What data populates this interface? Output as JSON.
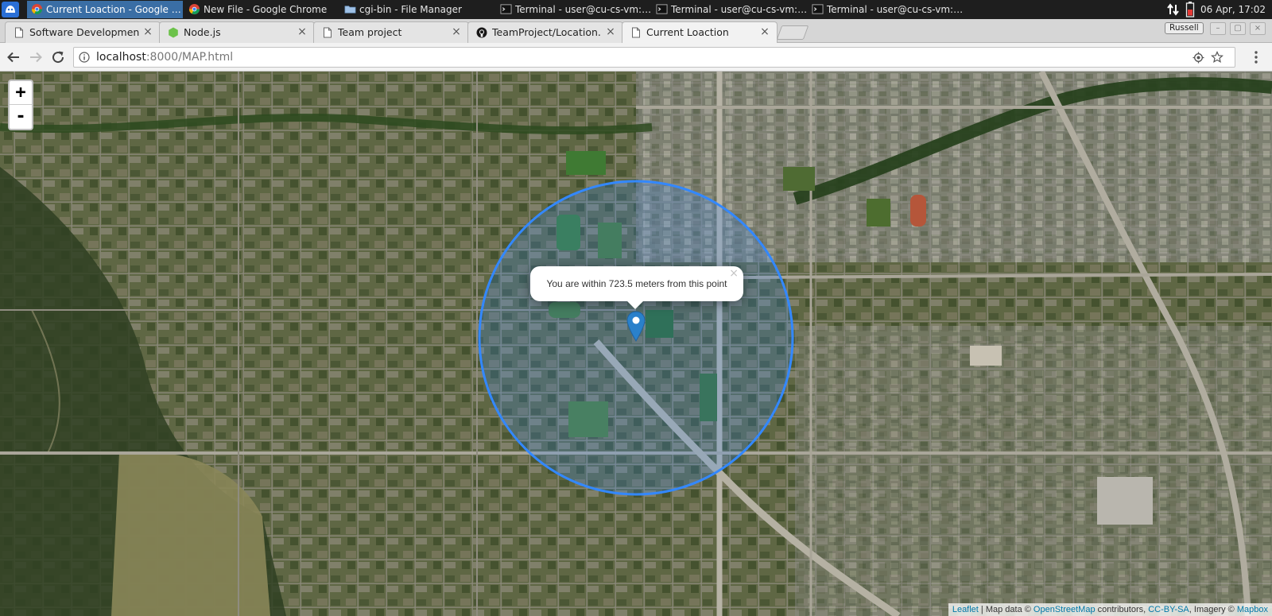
{
  "taskbar": {
    "items": [
      {
        "label": "Current Loaction - Google C...",
        "icon": "chrome-icon",
        "active": true
      },
      {
        "label": "New File - Google Chrome",
        "icon": "chrome-icon",
        "active": false
      },
      {
        "label": "cgi-bin - File Manager",
        "icon": "folder-icon",
        "active": false
      },
      {
        "label": "Terminal - user@cu-cs-vm: ~...",
        "icon": "terminal-icon",
        "active": false
      },
      {
        "label": "Terminal - user@cu-cs-vm: ~...",
        "icon": "terminal-icon",
        "active": false
      },
      {
        "label": "Terminal - user@cu-cs-vm: ~...",
        "icon": "terminal-icon",
        "active": false
      }
    ],
    "clock": "06 Apr, 17:02"
  },
  "browser": {
    "tabs": [
      {
        "label": "Software Development",
        "icon": "page-icon",
        "active": false
      },
      {
        "label": "Node.js",
        "icon": "nodejs-icon",
        "active": false
      },
      {
        "label": "Team project",
        "icon": "page-icon",
        "active": false
      },
      {
        "label": "TeamProject/Location.h",
        "icon": "github-icon",
        "active": false
      },
      {
        "label": "Current Loaction",
        "icon": "page-icon",
        "active": true
      }
    ],
    "profile_name": "Russell",
    "address": {
      "host": "localhost",
      "rest": ":8000/MAP.html"
    }
  },
  "map": {
    "zoom_in_label": "+",
    "zoom_out_label": "-",
    "popup_text": "You are within 723.5 meters from this point",
    "popup_close": "×",
    "attribution": {
      "leaflet": "Leaflet",
      "sep1": " | Map data © ",
      "osm": "OpenStreetMap",
      "contrib": " contributors, ",
      "license": "CC-BY-SA",
      "imagery": ", Imagery © ",
      "mapbox": "Mapbox"
    },
    "colors": {
      "accuracy_circle": "#3388ff",
      "marker": "#2a81cb"
    }
  }
}
